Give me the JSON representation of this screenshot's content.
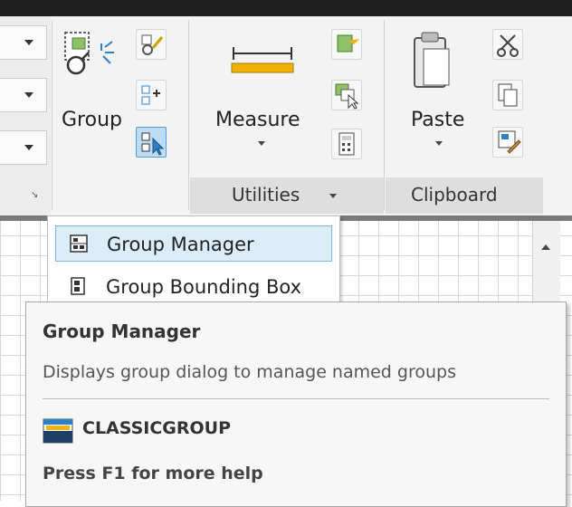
{
  "ribbon": {
    "group_label": "Group",
    "measure_label": "Measure",
    "paste_label": "Paste",
    "utilities_label": "Utilities",
    "clipboard_label": "Clipboard"
  },
  "menu": {
    "items": [
      {
        "label": "Group Manager",
        "icon": "group-manager-icon",
        "highlighted": true
      },
      {
        "label": "Group Bounding Box",
        "icon": "group-bounding-box-icon",
        "highlighted": false
      }
    ]
  },
  "tooltip": {
    "title": "Group Manager",
    "description": "Displays group dialog to manage named groups",
    "command": "CLASSICGROUP",
    "help": "Press F1 for more help"
  },
  "colors": {
    "highlight": "#dbecfb",
    "active_button": "#bcdcf3",
    "accent_blue": "#2f7ec8"
  }
}
